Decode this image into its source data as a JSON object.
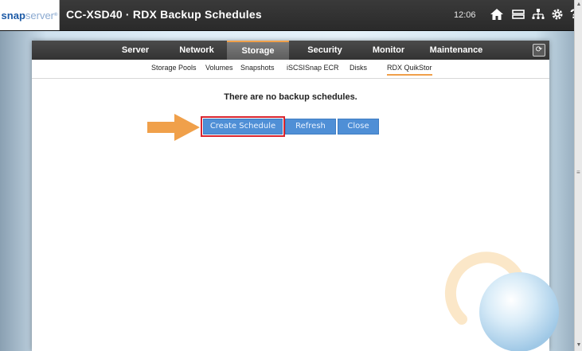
{
  "header": {
    "logo_snap": "snap",
    "logo_server": "server",
    "title": "CC-XSD40 · RDX Backup Schedules",
    "clock": "12:06",
    "icons": [
      "home-icon",
      "storage-icon",
      "network-icon",
      "settings-icon",
      "help-icon"
    ],
    "help_glyph": "?"
  },
  "main_nav": {
    "items": [
      {
        "label": "Server"
      },
      {
        "label": "Network"
      },
      {
        "label": "Storage",
        "active": true
      },
      {
        "label": "Security"
      },
      {
        "label": "Monitor"
      },
      {
        "label": "Maintenance"
      }
    ],
    "refresh_icon": "refresh-icon"
  },
  "sub_nav": {
    "items": [
      {
        "label": "Storage Pools"
      },
      {
        "label": "Volumes"
      },
      {
        "label": "Snapshots"
      },
      {
        "label": "iSCSI"
      },
      {
        "label": "Snap ECR"
      },
      {
        "label": "Disks"
      },
      {
        "label": "RDX QuikStor",
        "active": true
      }
    ]
  },
  "content": {
    "message": "There are no backup schedules.",
    "buttons": {
      "create": "Create Schedule",
      "refresh": "Refresh",
      "close": "Close"
    }
  },
  "colors": {
    "accent_orange": "#f0a04a",
    "button_blue": "#4f8fd6",
    "highlight_red": "#d9252f",
    "header_dark": "#333333"
  }
}
